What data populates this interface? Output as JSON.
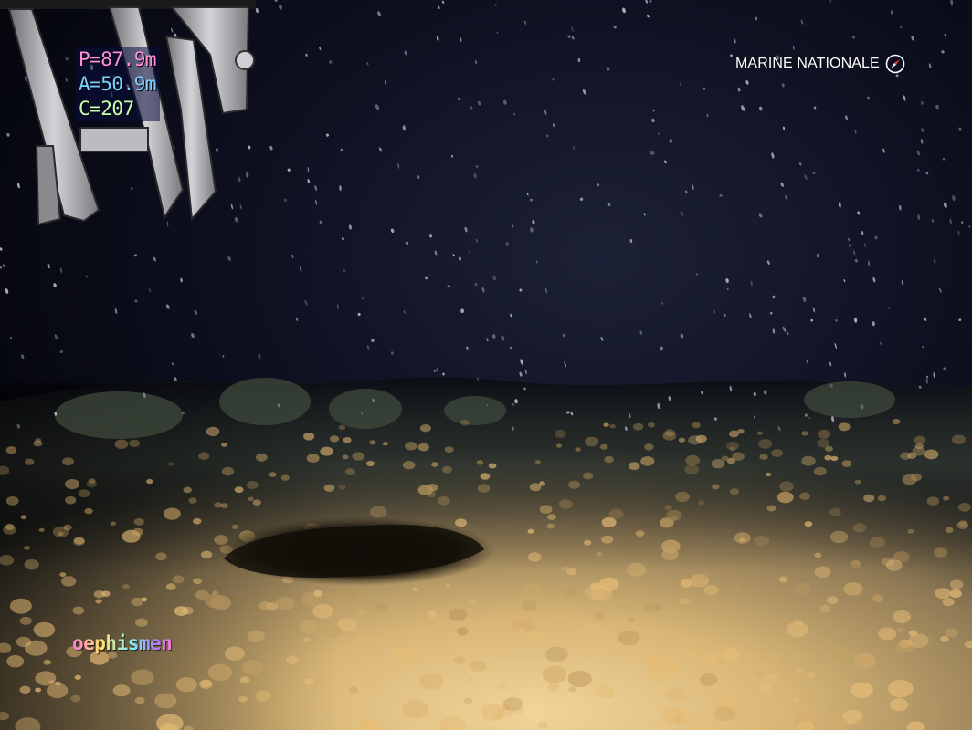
{
  "hud": {
    "pressure": "P=87.9m",
    "altitude": "A=50.9m",
    "heading": "C=207"
  },
  "watermark": {
    "text": "MARINE NATIONALE",
    "icon": "compass-rose-icon",
    "color": "#ffffff"
  },
  "camera_overlay": {
    "label": "oephismen"
  },
  "colors": {
    "water": "#05060c",
    "seabed_lit": "#d9b77a",
    "seabed_dark": "#5a4a30",
    "particles": "#c9c9dd"
  }
}
